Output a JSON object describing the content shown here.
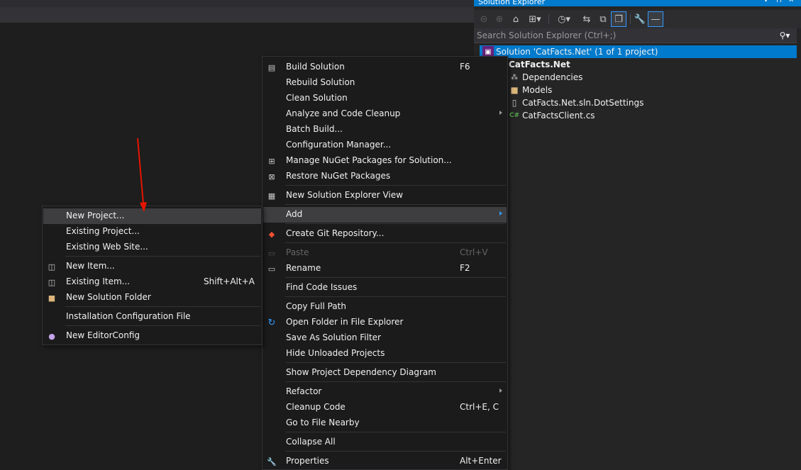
{
  "solution_explorer": {
    "title": "Solution Explorer",
    "search_placeholder": "Search Solution Explorer (Ctrl+;)",
    "toolbar_icons": [
      "back-icon",
      "forward-icon",
      "home-icon",
      "switch-views-icon",
      "pending-changes-filter-icon",
      "sync-icon",
      "collapse-all-icon",
      "show-all-files-icon",
      "properties-icon",
      "preview-icon"
    ],
    "tree": {
      "solution": "Solution 'CatFacts.Net' (1 of 1 project)",
      "project": "CatFacts.Net",
      "items": [
        "Dependencies",
        "Models",
        "CatFacts.Net.sln.DotSettings",
        "CatFactsClient.cs"
      ]
    }
  },
  "context_menu": {
    "items": {
      "build_solution": {
        "label": "Build Solution",
        "shortcut": "F6",
        "icon": "build-icon"
      },
      "rebuild_solution": {
        "label": "Rebuild Solution"
      },
      "clean_solution": {
        "label": "Clean Solution"
      },
      "analyze_cleanup": {
        "label": "Analyze and Code Cleanup"
      },
      "batch_build": {
        "label": "Batch Build..."
      },
      "configuration_manager": {
        "label": "Configuration Manager..."
      },
      "manage_nuget": {
        "label": "Manage NuGet Packages for Solution...",
        "icon": "nuget-icon"
      },
      "restore_nuget": {
        "label": "Restore NuGet Packages",
        "icon": "restore-packages-icon"
      },
      "new_se_view": {
        "label": "New Solution Explorer View",
        "icon": "new-view-icon"
      },
      "add": {
        "label": "Add"
      },
      "create_git_repo": {
        "label": "Create Git Repository...",
        "icon": "git-icon"
      },
      "paste": {
        "label": "Paste",
        "shortcut": "Ctrl+V",
        "icon": "paste-icon"
      },
      "rename": {
        "label": "Rename",
        "shortcut": "F2",
        "icon": "rename-icon"
      },
      "find_code_issues": {
        "label": "Find Code Issues"
      },
      "copy_full_path": {
        "label": "Copy Full Path"
      },
      "open_folder": {
        "label": "Open Folder in File Explorer",
        "icon": "open-folder-icon"
      },
      "save_filter": {
        "label": "Save As Solution Filter"
      },
      "hide_unloaded": {
        "label": "Hide Unloaded Projects"
      },
      "show_dependency_diagram": {
        "label": "Show Project Dependency Diagram"
      },
      "refactor": {
        "label": "Refactor"
      },
      "cleanup_code": {
        "label": "Cleanup Code",
        "shortcut": "Ctrl+E, C"
      },
      "go_to_file_nearby": {
        "label": "Go to File Nearby"
      },
      "collapse_all": {
        "label": "Collapse All"
      },
      "properties": {
        "label": "Properties",
        "shortcut": "Alt+Enter",
        "icon": "wrench-icon"
      }
    }
  },
  "add_submenu": {
    "items": {
      "new_project": {
        "label": "New Project..."
      },
      "existing_project": {
        "label": "Existing Project..."
      },
      "existing_website": {
        "label": "Existing Web Site..."
      },
      "new_item": {
        "label": "New Item...",
        "icon": "new-item-icon"
      },
      "existing_item": {
        "label": "Existing Item...",
        "shortcut": "Shift+Alt+A",
        "icon": "existing-item-icon"
      },
      "new_solution_folder": {
        "label": "New Solution Folder",
        "icon": "new-folder-icon"
      },
      "installation_config": {
        "label": "Installation Configuration File"
      },
      "new_editorconfig": {
        "label": "New EditorConfig",
        "icon": "lightbulb-icon"
      }
    }
  },
  "colors": {
    "accent": "#007acc",
    "menu_bg": "#1b1b1c",
    "menu_highlight": "#3e3e40",
    "annotation_arrow": "#e51400"
  }
}
